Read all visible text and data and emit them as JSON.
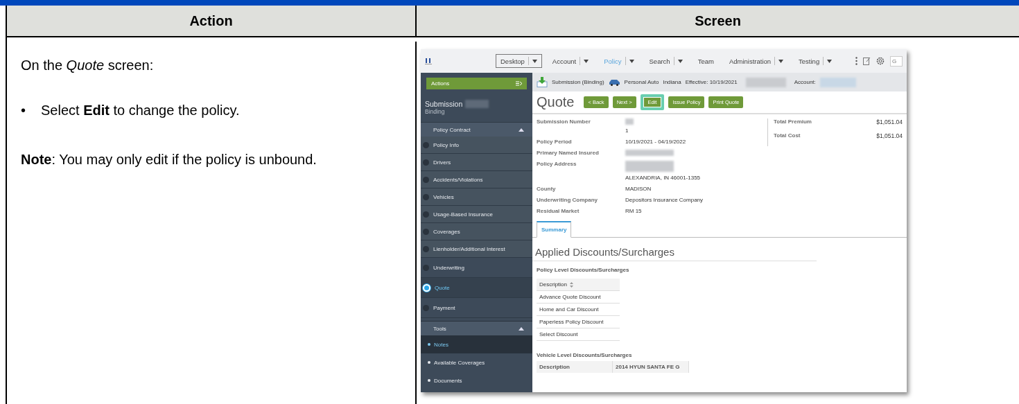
{
  "table_header": [
    "Action",
    "Screen"
  ],
  "action": {
    "intro": "On the *Quote* screen:",
    "bullets": [
      {
        "marker": "•",
        "text": "Select **Edit** to change the policy."
      }
    ],
    "note": "**Note**: You may only edit if the policy is unbound."
  },
  "app": {
    "nav": [
      {
        "label": "Desktop",
        "dropdown": true,
        "focused": true,
        "selected": false
      },
      {
        "label": "Account",
        "dropdown": true,
        "focused": false,
        "selected": false
      },
      {
        "label": "Policy",
        "dropdown": true,
        "focused": false,
        "selected": true
      },
      {
        "label": "Search",
        "dropdown": true,
        "focused": false,
        "selected": false
      },
      {
        "label": "Team",
        "dropdown": false,
        "focused": false,
        "selected": false
      },
      {
        "label": "Administration",
        "dropdown": true,
        "focused": false,
        "selected": false
      },
      {
        "label": "Testing",
        "dropdown": true,
        "focused": false,
        "selected": false
      }
    ],
    "search": {
      "placeholder": "G"
    },
    "info_bar": {
      "job": "Submission (Binding)",
      "product": "Personal Auto",
      "state": "Indiana",
      "effective": "Effective: 10/19/2021",
      "account_label": "Account:"
    },
    "sidebar": {
      "actions": "Actions",
      "title": "Submission",
      "subtitle": "Binding",
      "steps": [
        {
          "label": "Policy Contract",
          "kind": "group",
          "expanded": true,
          "children": [
            {
              "label": "Policy Info",
              "selected": false
            },
            {
              "label": "Drivers",
              "selected": false
            },
            {
              "label": "Accidents/Violations",
              "selected": false
            },
            {
              "label": "Vehicles",
              "selected": false
            },
            {
              "label": "Usage-Based Insurance",
              "selected": false
            },
            {
              "label": "Coverages",
              "selected": false
            },
            {
              "label": "Lienholder/Additional Interest",
              "selected": false
            }
          ]
        },
        {
          "label": "Underwriting",
          "kind": "step",
          "selected": false
        },
        {
          "label": "Quote",
          "kind": "step",
          "selected": true
        },
        {
          "label": "Payment",
          "kind": "step",
          "selected": false
        }
      ],
      "tools": {
        "label": "Tools",
        "expanded": true,
        "items": [
          {
            "label": "Notes",
            "selected": true
          },
          {
            "label": "Available Coverages",
            "selected": false
          },
          {
            "label": "Documents",
            "selected": false
          }
        ]
      }
    },
    "page": {
      "title": "Quote",
      "buttons": [
        {
          "label": "< Back",
          "highlighted": false
        },
        {
          "label": "Next >",
          "highlighted": false
        },
        {
          "label": "Edit",
          "highlighted": true
        },
        {
          "label": "Issue Policy",
          "highlighted": false
        },
        {
          "label": "Print Quote",
          "highlighted": false
        }
      ],
      "fields": [
        {
          "label": "Submission Number",
          "value": "1",
          "redacted": true
        },
        {
          "label": "Policy Period",
          "value": "10/19/2021 - 04/19/2022",
          "redacted": false
        },
        {
          "label": "Primary Named Insured",
          "redacted": true
        },
        {
          "label": "Policy Address",
          "value": "ALEXANDRIA, IN 46001-1355",
          "redacted": true
        },
        {
          "label": "County",
          "value": "MADISON",
          "redacted": false
        },
        {
          "label": "Underwriting Company",
          "value": "Depositors Insurance Company",
          "redacted": false
        },
        {
          "label": "Residual Market",
          "value": "RM 15",
          "redacted": false
        }
      ],
      "totals": [
        {
          "label": "Total Premium",
          "value": "$1,051.04"
        },
        {
          "label": "Total Cost",
          "value": "$1,051.04"
        }
      ],
      "tabs": [
        {
          "label": "Summary",
          "selected": true
        }
      ],
      "section_title": "Applied Discounts/Surcharges",
      "policy_level": {
        "title": "Policy Level Discounts/Surcharges",
        "header": "Description",
        "sortable": true,
        "rows": [
          "Advance Quote Discount",
          "Home and Car Discount",
          "Paperless Policy Discount",
          "Select Discount"
        ]
      },
      "vehicle_level": {
        "title": "Vehicle Level Discounts/Surcharges",
        "columns": [
          "Description",
          "2014 HYUN SANTA FE G"
        ]
      }
    }
  }
}
